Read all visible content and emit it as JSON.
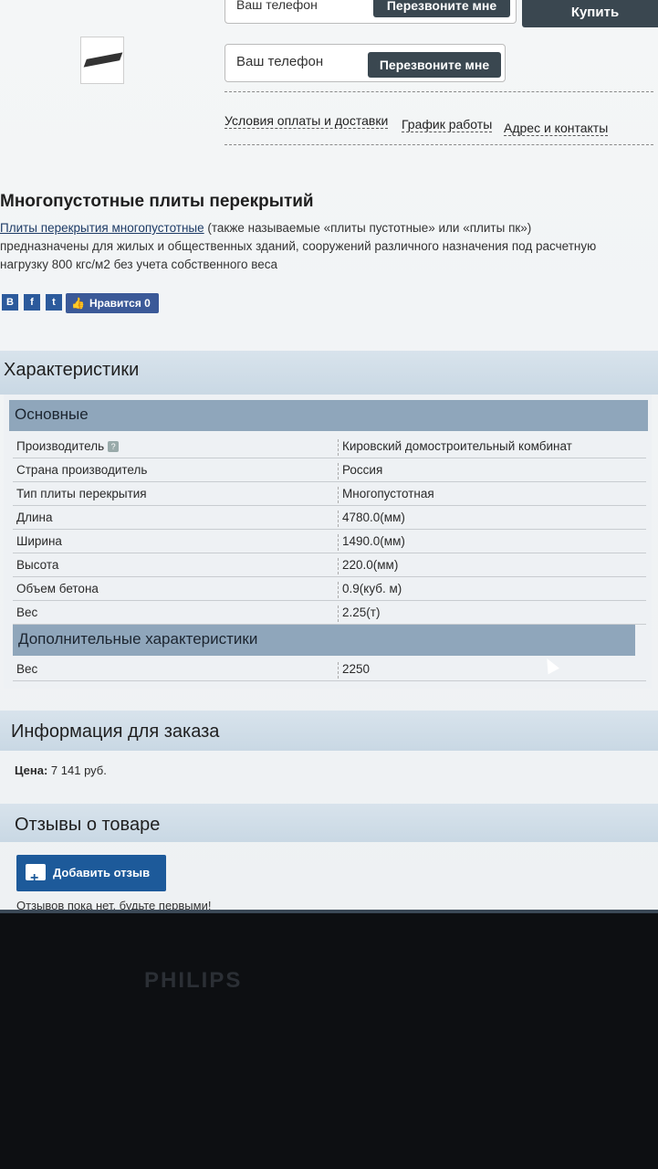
{
  "top_bar": {
    "phone_label": "Ваш телефон",
    "callback_label": "Перезвоните мне",
    "buy_label": "Купить"
  },
  "callback_form": {
    "phone_label": "Ваш телефон",
    "callback_label": "Перезвоните мне"
  },
  "info_links": [
    "Условия оплаты и доставки",
    "График работы",
    "Адрес и контакты"
  ],
  "product": {
    "title": "Многопустотные плиты перекрытий",
    "intro_link": "Плиты перекрытия многопустотные",
    "intro_line1": " (также называемые «плиты пустотные» или «плиты пк»)",
    "intro_line2": "предназначены для жилых и общественных зданий, сооружений различного назначения под расчетную",
    "intro_line3": "нагрузку 800 кгс/м2 без учета собственного веса"
  },
  "social": {
    "vk": "B",
    "fb": "f",
    "tw": "t",
    "like_label": "Нравится 0"
  },
  "characteristics": {
    "heading": "Характеристики",
    "main_group": "Основные",
    "rows": [
      {
        "key": "Производитель",
        "value": "Кировский домостроительный комбинат"
      },
      {
        "key": "Страна производитель",
        "value": "Россия"
      },
      {
        "key": "Тип плиты перекрытия",
        "value": "Многопустотная"
      },
      {
        "key": "Длина",
        "value": "4780.0(мм)"
      },
      {
        "key": "Ширина",
        "value": "1490.0(мм)"
      },
      {
        "key": "Высота",
        "value": "220.0(мм)"
      },
      {
        "key": "Объем бетона",
        "value": "0.9(куб. м)"
      },
      {
        "key": "Вес",
        "value": "2.25(т)"
      }
    ],
    "extra_group": "Дополнительные характеристики",
    "extra_rows": [
      {
        "key": "Вес",
        "value": "2250"
      }
    ]
  },
  "order": {
    "heading": "Информация для заказа",
    "price_label": "Цена:",
    "price_value": "7 141 руб."
  },
  "reviews": {
    "heading": "Отзывы о товаре",
    "add_button": "Добавить отзыв",
    "empty_text": "Отзывов пока нет, будьте первыми!"
  },
  "monitor": {
    "brand": "PHILIPS"
  }
}
